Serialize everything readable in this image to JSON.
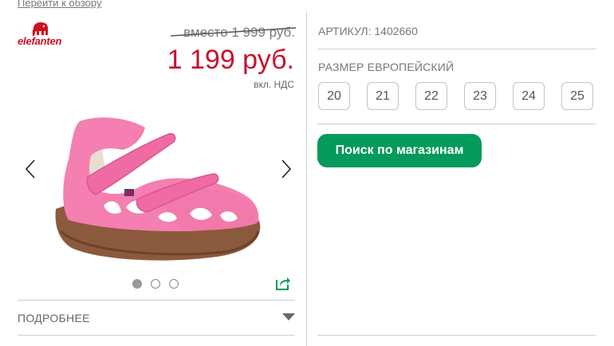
{
  "nav": {
    "back_label": "Перейти к обзору"
  },
  "brand": {
    "name": "elefanten",
    "color": "#d0101e"
  },
  "price": {
    "old_label": "вместо 1 999 руб.",
    "new_label": "1 199 руб.",
    "vat_label": "вкл. НДС",
    "new_color": "#c8102e"
  },
  "gallery": {
    "prev_icon": "chevron-left-icon",
    "next_icon": "chevron-right-icon",
    "image": "pink-kids-sandal",
    "slide_count": 3,
    "active_slide": 1,
    "share_icon": "share-icon"
  },
  "details": {
    "label": "ПОДРОБНЕЕ",
    "icon": "triangle-down-icon"
  },
  "product": {
    "sku_label": "АРТИКУЛ: 1402660",
    "size_label": "РАЗМЕР ЕВРОПЕЙСКИЙ",
    "sizes": [
      "20",
      "21",
      "22",
      "23",
      "24",
      "25"
    ]
  },
  "actions": {
    "store_search_label": "Поиск по магазинам",
    "accent": "#049a5c"
  }
}
